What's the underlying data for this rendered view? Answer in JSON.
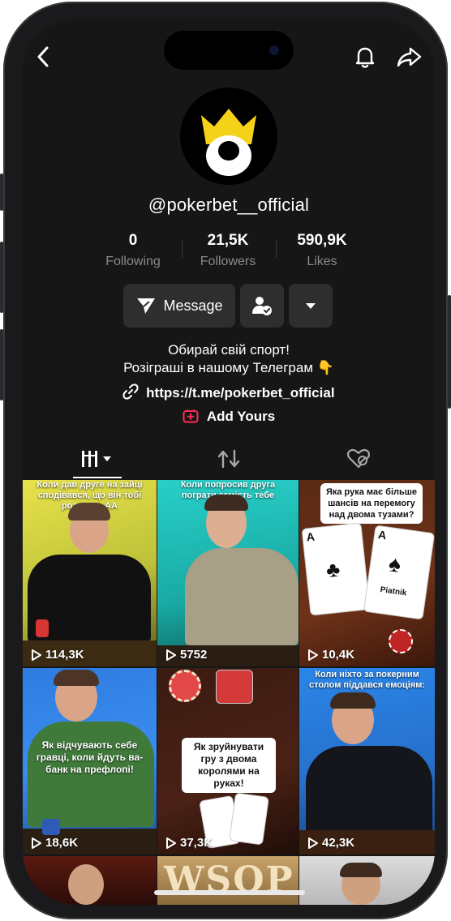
{
  "profile": {
    "handle": "@pokerbet__official",
    "stats": [
      {
        "value": "0",
        "label": "Following"
      },
      {
        "value": "21,5K",
        "label": "Followers"
      },
      {
        "value": "590,9K",
        "label": "Likes"
      }
    ],
    "message_label": "Message",
    "bio_line1": "Обирай свій спорт!",
    "bio_line2": "Розіграші в нашому Телеграм 👇",
    "link": "https://t.me/pokerbet_official",
    "add_yours": "Add Yours"
  },
  "icons": {
    "back": "chevron-left-icon",
    "bell": "bell-icon",
    "share": "share-icon",
    "message": "send-icon",
    "follow": "user-check-icon",
    "more": "caret-down-icon",
    "link": "link-icon",
    "add_yours": "add-yours-icon",
    "tab_videos": "grid-videos-icon",
    "tab_reposts": "repost-icon",
    "tab_liked": "liked-hidden-icon",
    "play": "play-icon"
  },
  "colors": {
    "background": "#161616",
    "accent": "#fe2c55",
    "logo_yellow": "#f5d21a"
  },
  "videos": [
    {
      "views": "114,3K",
      "caption": "Коли дав друге на зайці сподівався, що він тобі роздасть АА"
    },
    {
      "views": "5752",
      "caption": "Коли попросив друга пограти замість тебе"
    },
    {
      "views": "10,4K",
      "caption": "Яка рука має більше шансів на перемогу над двома тузами?"
    },
    {
      "views": "18,6K",
      "caption": "Як відчувають себе гравці, коли йдуть ва-банк на префлопі!"
    },
    {
      "views": "37,3K",
      "caption": "Як зруйнувати гру з двома королями на руках!"
    },
    {
      "views": "42,3K",
      "caption": "Коли ніхто за покерним столом піддався емоціям:"
    },
    {
      "views": "",
      "caption": ""
    },
    {
      "views": "",
      "caption": ""
    },
    {
      "views": "",
      "caption": ""
    }
  ],
  "cards": {
    "ace_clubs_rank": "A",
    "ace_spades_rank": "A",
    "ace_spades_brand": "Piatnik"
  }
}
